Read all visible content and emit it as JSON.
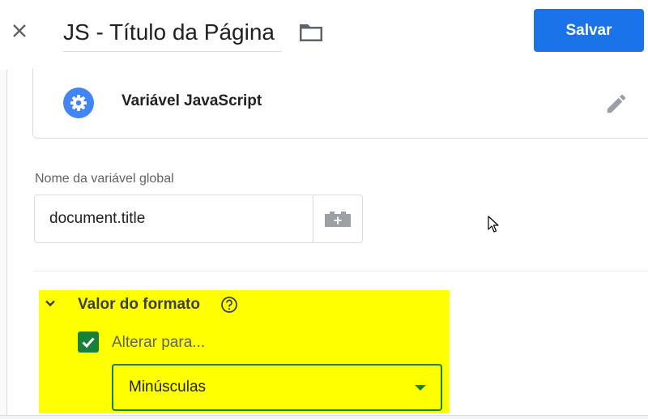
{
  "header": {
    "title": "JS - Título da Página",
    "save_label": "Salvar",
    "accent_color": "#1a73e8"
  },
  "variable_type": {
    "label": "Variável JavaScript",
    "icon": "gear-icon",
    "edit_icon": "pencil-icon"
  },
  "global_variable": {
    "label": "Nome da variável global",
    "value": "document.title",
    "picker_icon": "add-variable-icon"
  },
  "format_section": {
    "title": "Valor do formato",
    "help_icon": "help-icon",
    "toggle_icon": "chevron-down-icon",
    "highlight_color": "#ffff00",
    "checkbox": {
      "label": "Alterar para...",
      "checked": true,
      "color": "#188038"
    },
    "select": {
      "selected": "Minúsculas"
    }
  }
}
